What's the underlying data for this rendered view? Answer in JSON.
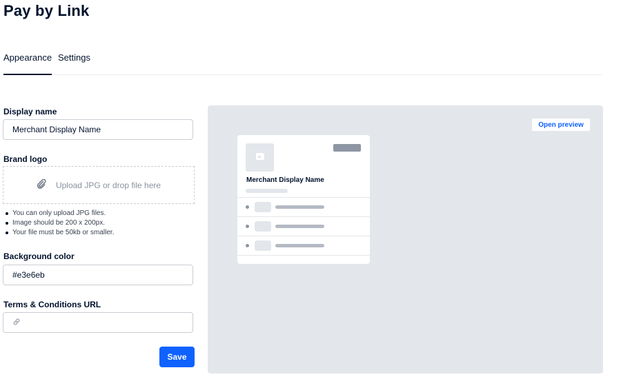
{
  "page": {
    "title": "Pay by Link"
  },
  "tabs": [
    {
      "label": "Appearance",
      "active": true
    },
    {
      "label": "Settings",
      "active": false
    }
  ],
  "form": {
    "display_name": {
      "label": "Display name",
      "value": "Merchant Display Name"
    },
    "brand_logo": {
      "label": "Brand logo",
      "upload_text": "Upload JPG or drop file here",
      "icon": "paperclip-icon",
      "hints": [
        "You can only upload JPG files.",
        "Image should be 200 x 200px.",
        "Your file must be 50kb or smaller."
      ]
    },
    "background_color": {
      "label": "Background color",
      "value": "#e3e6eb"
    },
    "terms_url": {
      "label": "Terms & Conditions URL",
      "value": "",
      "icon": "link-icon"
    },
    "save_label": "Save"
  },
  "preview": {
    "open_preview_label": "Open preview",
    "merchant_name": "Merchant Display Name",
    "row_count": 3,
    "panel_color": "#e3e6eb"
  },
  "colors": {
    "primary": "#0f62fe",
    "text": "#00112c",
    "muted_bar": "#8e96a3"
  }
}
